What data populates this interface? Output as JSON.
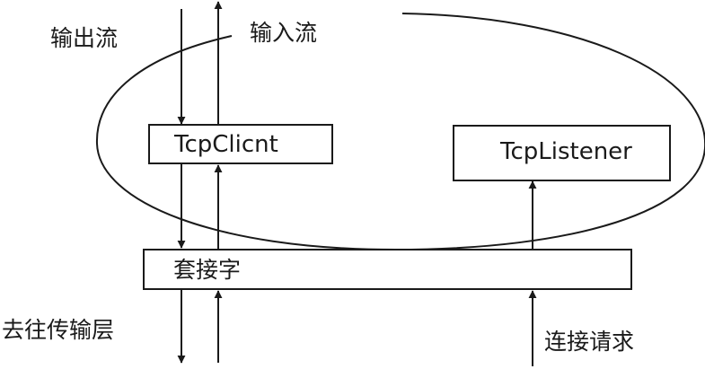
{
  "labels": {
    "output_stream": "输出流",
    "input_stream": "输入流",
    "to_transport_layer": "去往传输层",
    "connection_request": "连接请求"
  },
  "boxes": {
    "tcp_client": "TcpClicnt",
    "tcp_listener": "TcpListener",
    "socket": "套接字"
  },
  "colors": {
    "stroke": "#1a1a1a",
    "background": "#ffffff"
  }
}
